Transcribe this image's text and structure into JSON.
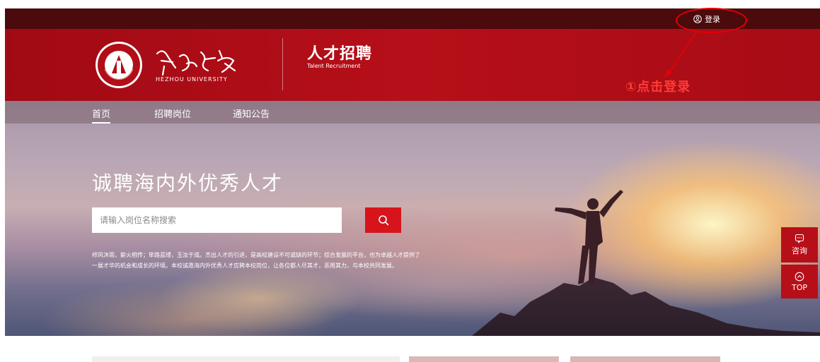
{
  "top_bar": {
    "login_label": "登录"
  },
  "header": {
    "university_script": "贺州学院",
    "university_en": "HEZHOU UNIVERSITY",
    "seal_text": "HEZHOU UNIVERSITY",
    "title": "人才招聘",
    "subtitle": "Talent Recruitment"
  },
  "annotation": {
    "text": "①点击登录",
    "color": "#e30008"
  },
  "nav": {
    "items": [
      {
        "label": "首页"
      },
      {
        "label": "招聘岗位"
      },
      {
        "label": "通知公告"
      }
    ],
    "active_index": 0
  },
  "hero": {
    "title": "诚聘海内外优秀人才",
    "search_placeholder": "请输入岗位名称搜索",
    "description": "栉风沐雨，薪火相传；筚路蓝缕，玉汝于成。杰出人才的引进，是高校建设不可或缺的环节；综合发展的平台，也为卓越人才提供了一展才华的机会和成长的环境。本校诚邀海内外优秀人才应聘本校岗位，让各位都人尽其才，恶用其力，与本校共同发展。"
  },
  "float_buttons": {
    "consult_label": "咨询",
    "top_label": "TOP"
  },
  "colors": {
    "brand_red": "#b60f19",
    "dark_strip": "#4b0a0c",
    "search_red": "#d7141b"
  }
}
